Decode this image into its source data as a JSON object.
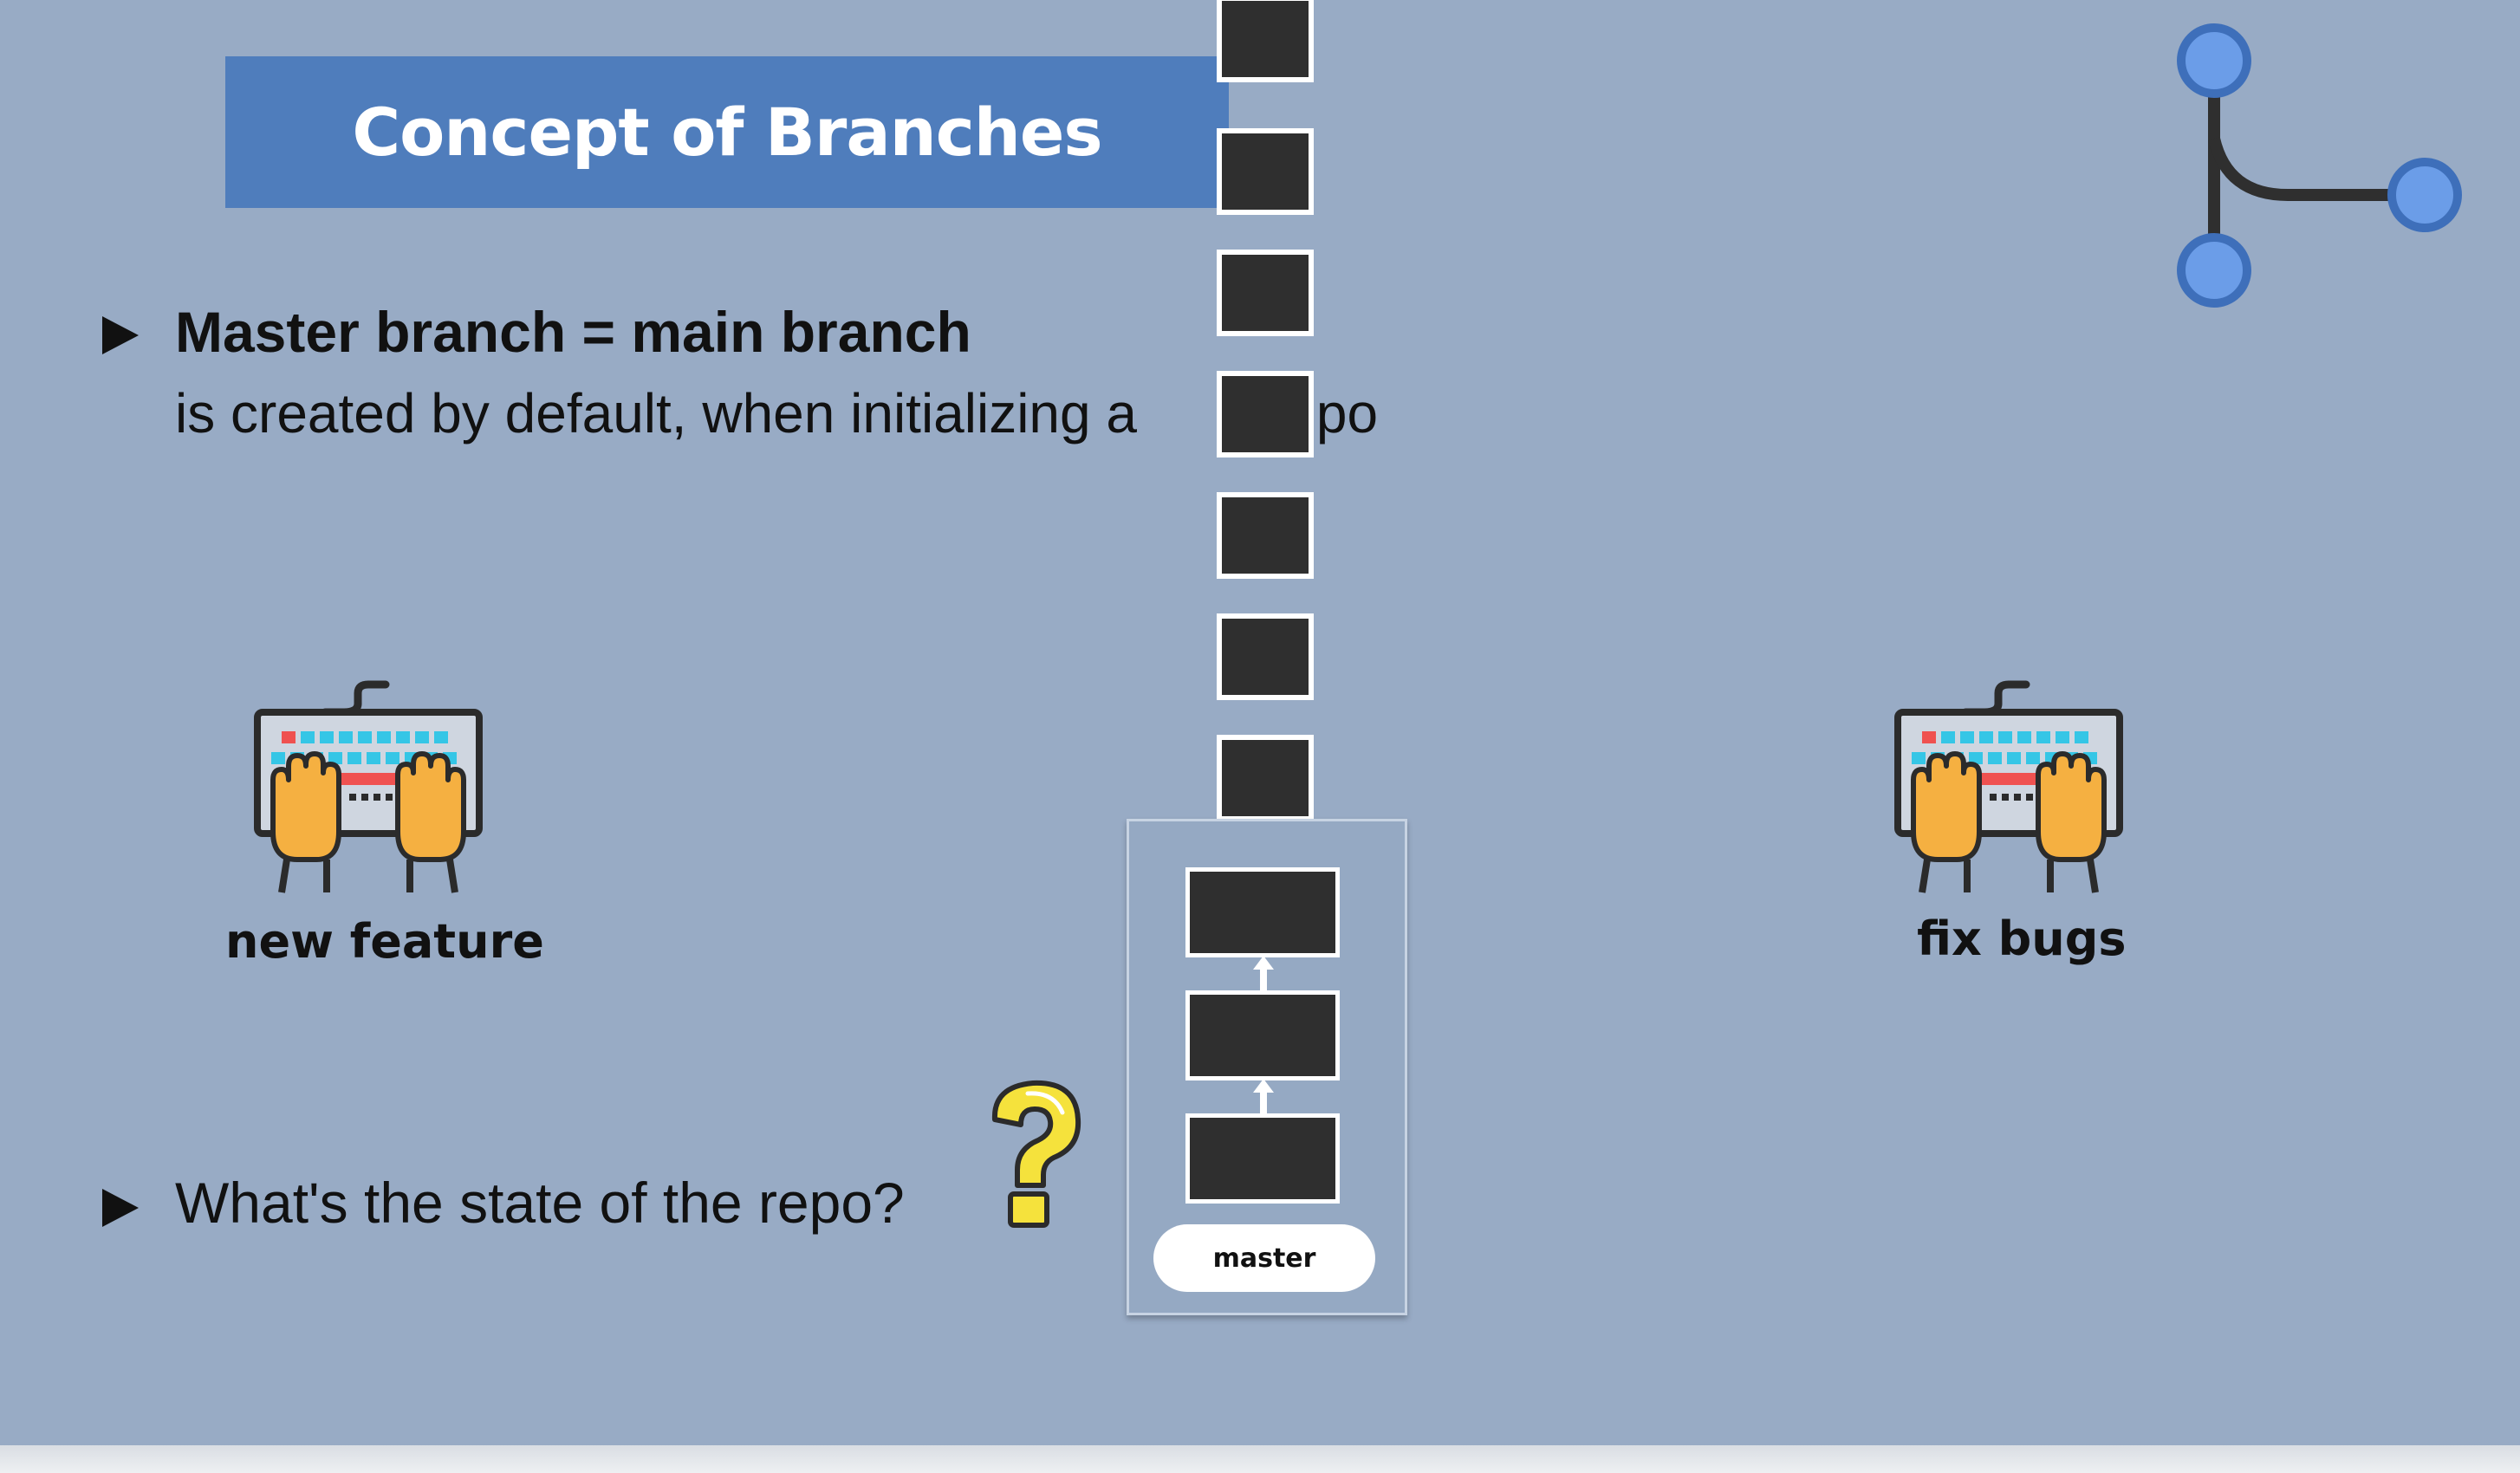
{
  "title": "Concept of Branches",
  "bullets": [
    {
      "heading": "Master branch = main branch",
      "text": "is created by default, when initializing a",
      "text_tail": "repo"
    },
    {
      "text": "What's the state of the repo?"
    }
  ],
  "captions": {
    "left": "new feature",
    "right": "fix bugs"
  },
  "branch_label": "master",
  "icons": [
    "keyboard-hands-icon",
    "question-mark-icon",
    "git-branch-icon",
    "play-arrow-icon"
  ],
  "colors": {
    "background": "#98abc5",
    "banner": "#4f7dbc",
    "commit": "#2f2f2f",
    "branch_node": "#6b9de8"
  }
}
